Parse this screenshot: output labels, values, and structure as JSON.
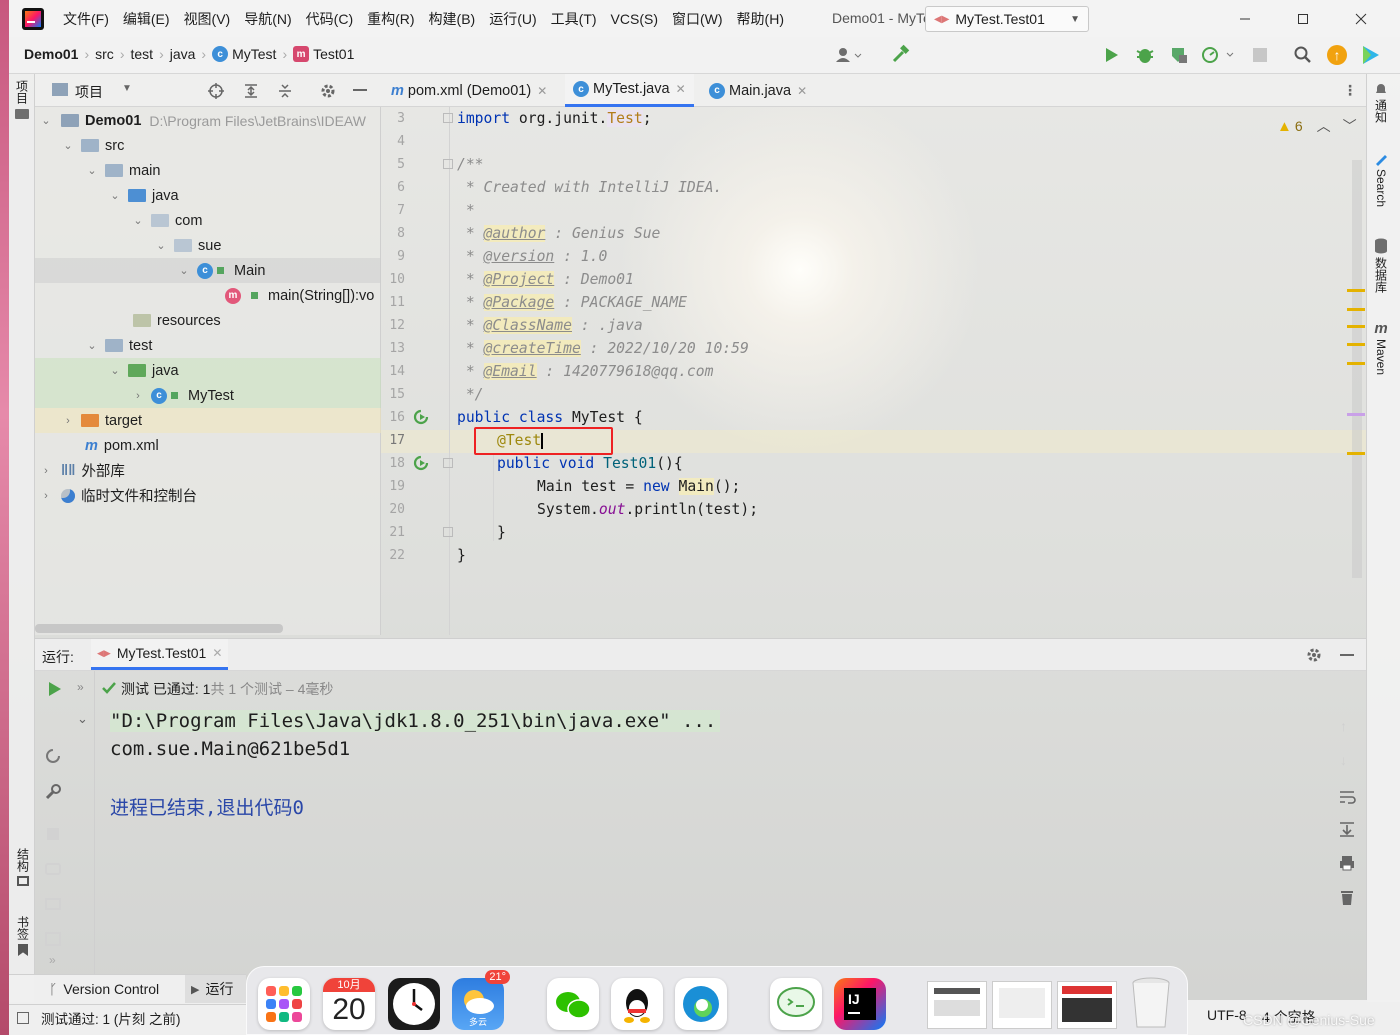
{
  "window": {
    "title": "Demo01 - MyTest.java"
  },
  "menu": [
    "文件(F)",
    "编辑(E)",
    "视图(V)",
    "导航(N)",
    "代码(C)",
    "重构(R)",
    "构建(B)",
    "运行(U)",
    "工具(T)",
    "VCS(S)",
    "窗口(W)",
    "帮助(H)"
  ],
  "breadcrumbs": [
    "Demo01",
    "src",
    "test",
    "java",
    "MyTest",
    "Test01"
  ],
  "run_config": "MyTest.Test01",
  "left_strip": {
    "top": "项目",
    "structure": "结构",
    "bookmarks": "书签"
  },
  "right_strip": [
    "通知",
    "Search",
    "数据库",
    "Maven"
  ],
  "project": {
    "header": "项目",
    "root_label": "Demo01",
    "root_path": "D:\\Program Files\\JetBrains\\IDEAW",
    "items": [
      {
        "label": "src"
      },
      {
        "label": "main"
      },
      {
        "label": "java"
      },
      {
        "label": "com"
      },
      {
        "label": "sue"
      },
      {
        "label": "Main"
      },
      {
        "label": "main(String[]):vo"
      },
      {
        "label": "resources"
      },
      {
        "label": "test"
      },
      {
        "label": "java"
      },
      {
        "label": "MyTest"
      },
      {
        "label": "target"
      },
      {
        "label": "pom.xml"
      },
      {
        "label": "外部库"
      },
      {
        "label": "临时文件和控制台"
      }
    ]
  },
  "tabs": [
    {
      "label": "pom.xml (Demo01)"
    },
    {
      "label": "MyTest.java"
    },
    {
      "label": "Main.java"
    }
  ],
  "editor": {
    "warnings": "6",
    "line_numbers": [
      "3",
      "4",
      "5",
      "6",
      "7",
      "8",
      "9",
      "10",
      "11",
      "12",
      "13",
      "14",
      "15",
      "16",
      "17",
      "18",
      "19",
      "20",
      "21",
      "22"
    ],
    "import_kw": "import",
    "import_pkg": "org.junit.",
    "import_cls": "Test",
    "import_end": ";",
    "doc_open": "/**",
    "doc_created": " * Created with IntelliJ IDEA.",
    "doc_star": " *",
    "doc_tags": [
      {
        "tag": "@author",
        "val": " : Genius Sue"
      },
      {
        "tag": "@version",
        "val": " : 1.0"
      },
      {
        "tag": "@Project",
        "val": " : Demo01"
      },
      {
        "tag": "@Package",
        "val": " : PACKAGE_NAME"
      },
      {
        "tag": "@ClassName",
        "val": " : .java"
      },
      {
        "tag": "@createTime",
        "val": " : 2022/10/20 10:59"
      },
      {
        "tag": "@Email",
        "val": " : 1420779618@qq.com"
      }
    ],
    "doc_close": " */",
    "kw_public": "public",
    "kw_class": "class",
    "class_name": "MyTest",
    "brace_open": "{",
    "annotation": "@Test",
    "kw_void": "void",
    "method": "Test01",
    "method_paren": "(){",
    "main_a": "Main test = ",
    "kw_new": "new",
    "main_b": "Main",
    "main_c": "();",
    "sys_a": "System.",
    "sys_out": "out",
    "sys_b": ".println(test);",
    "close_inner": "}",
    "close_outer": "}"
  },
  "run": {
    "label": "运行:",
    "tab": "MyTest.Test01",
    "status_a": "测试 已通过:",
    "status_b": " 1",
    "status_c": "共 1 个测试 – 4毫秒",
    "console": [
      "\"D:\\Program Files\\Java\\jdk1.8.0_251\\bin\\java.exe\" ...",
      "com.sue.Main@621be5d1",
      "",
      "进程已结束,退出代码0"
    ]
  },
  "bottom": {
    "vcs": "Version Control",
    "run": "运行",
    "status": "测试通过: 1 (片刻 之前)",
    "encoding": "UTF-8",
    "indent": "4 个空格",
    "watermark": "CSDN @Genius-Sue"
  },
  "dock": {
    "cal_month": "10月",
    "cal_day": "20",
    "weather_badge": "21°",
    "weather_text": "多云"
  }
}
